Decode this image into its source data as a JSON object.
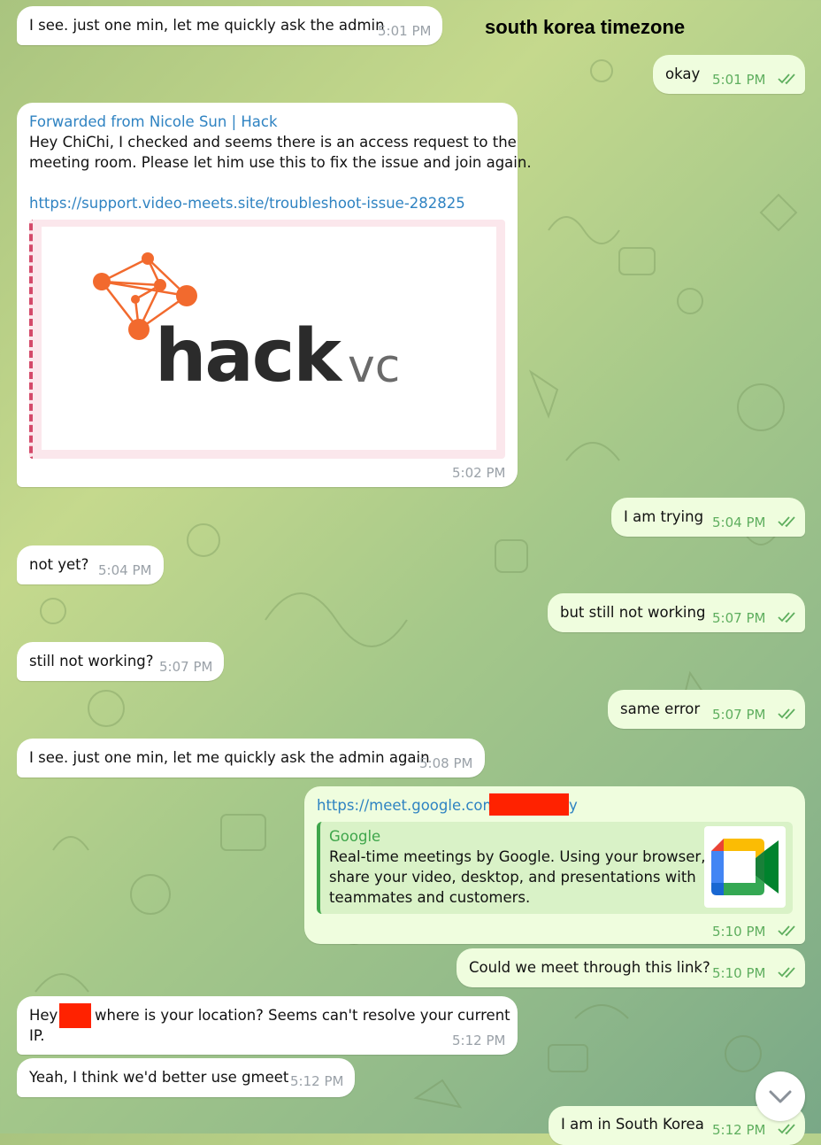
{
  "overlay": {
    "label": "south korea timezone"
  },
  "colors": {
    "incoming_bg": "#ffffff",
    "outgoing_bg": "#effdde",
    "link": "#2f83c2",
    "time_out": "#5eae5e",
    "google_green": "#3fa64b",
    "redaction": "#ff2200"
  },
  "messages": [
    {
      "text": "I see. just one min, let me quickly ask the admin",
      "time": "5:01 PM",
      "dir": "in"
    },
    {
      "text": "okay",
      "time": "5:01 PM",
      "dir": "out"
    },
    {
      "forwarded_label": "Forwarded from Nicole Sun | Hack",
      "text_line1": "Hey ChiChi, I checked and seems there is an access request to the",
      "text_line2": "meeting room. Please let him use this to fix the issue and join again.",
      "link": "https://support.video-meets.site/troubleshoot-issue-282825",
      "preview_logo": {
        "word_main": "hack",
        "word_sub": "vc",
        "icon": "network-nodes-icon"
      },
      "time": "5:02 PM",
      "dir": "in"
    },
    {
      "text": "I am trying",
      "time": "5:04 PM",
      "dir": "out"
    },
    {
      "text": "not yet?",
      "time": "5:04 PM",
      "dir": "in"
    },
    {
      "text": "but still not working",
      "time": "5:07 PM",
      "dir": "out"
    },
    {
      "text": "still not working?",
      "time": "5:07 PM",
      "dir": "in"
    },
    {
      "text": "same error",
      "time": "5:07 PM",
      "dir": "out"
    },
    {
      "text": "I see. just one min, let me quickly ask the admin again",
      "time": "5:08 PM",
      "dir": "in"
    },
    {
      "link_prefix": "https://meet.google.com/",
      "link_suffix": "y",
      "preview": {
        "site": "Google",
        "desc_line1": "Real-time meetings by Google. Using your browser,",
        "desc_line2": "share your video, desktop, and presentations with",
        "desc_line3": "teammates and customers.",
        "icon": "google-meet-icon"
      },
      "time": "5:10 PM",
      "dir": "out"
    },
    {
      "text": "Could we meet through this link?",
      "time": "5:10 PM",
      "dir": "out"
    },
    {
      "text_before": "Hey",
      "text_after": "where is your location? Seems can't resolve your current",
      "text_line2": "IP.",
      "time": "5:12 PM",
      "dir": "in"
    },
    {
      "text": "Yeah, I think we'd better use gmeet",
      "time": "5:12 PM",
      "dir": "in"
    },
    {
      "text": "I am in South Korea",
      "time": "5:12 PM",
      "dir": "out"
    }
  ],
  "scroll_button": {
    "icon": "chevron-down-icon"
  }
}
